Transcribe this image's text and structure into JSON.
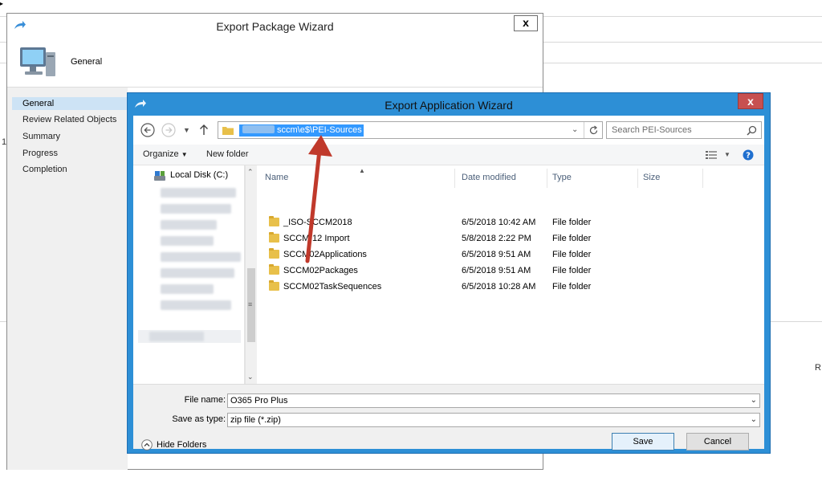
{
  "background": {
    "side_letters": [
      "1",
      "R"
    ]
  },
  "package_wizard": {
    "title": "Export Package Wizard",
    "close_label": "x",
    "header_label": "General",
    "nav": [
      {
        "label": "General",
        "selected": true
      },
      {
        "label": "Review Related Objects",
        "selected": false
      },
      {
        "label": "Summary",
        "selected": false
      },
      {
        "label": "Progress",
        "selected": false
      },
      {
        "label": "Completion",
        "selected": false
      }
    ]
  },
  "app_wizard": {
    "title": "Export Application Wizard",
    "close_label": "x",
    "address": {
      "path_visible": "sccm\\e$\\PEI-Sources"
    },
    "search": {
      "placeholder": "Search PEI-Sources"
    },
    "toolbar": {
      "organize": "Organize",
      "new_folder": "New folder"
    },
    "tree": {
      "local_disk": "Local Disk (C:)"
    },
    "columns": {
      "name": "Name",
      "date_modified": "Date modified",
      "type": "Type",
      "size": "Size"
    },
    "files": [
      {
        "name": "_ISO-SCCM2018",
        "date": "6/5/2018 10:42 AM",
        "type": "File folder"
      },
      {
        "name": "SCCM-12 Import",
        "date": "5/8/2018 2:22 PM",
        "type": "File folder"
      },
      {
        "name": "SCCM02Applications",
        "date": "6/5/2018 9:51 AM",
        "type": "File folder"
      },
      {
        "name": "SCCM02Packages",
        "date": "6/5/2018 9:51 AM",
        "type": "File folder"
      },
      {
        "name": "SCCM02TaskSequences",
        "date": "6/5/2018 10:28 AM",
        "type": "File folder"
      }
    ],
    "file_name_label": "File name:",
    "file_name_value": "O365 Pro Plus",
    "save_type_label": "Save as type:",
    "save_type_value": "zip file (*.zip)",
    "hide_folders": "Hide Folders",
    "save": "Save",
    "cancel": "Cancel"
  },
  "colors": {
    "accent": "#2d8fd6",
    "selection": "#3399ff",
    "annotation_arrow": "#c0392b"
  }
}
